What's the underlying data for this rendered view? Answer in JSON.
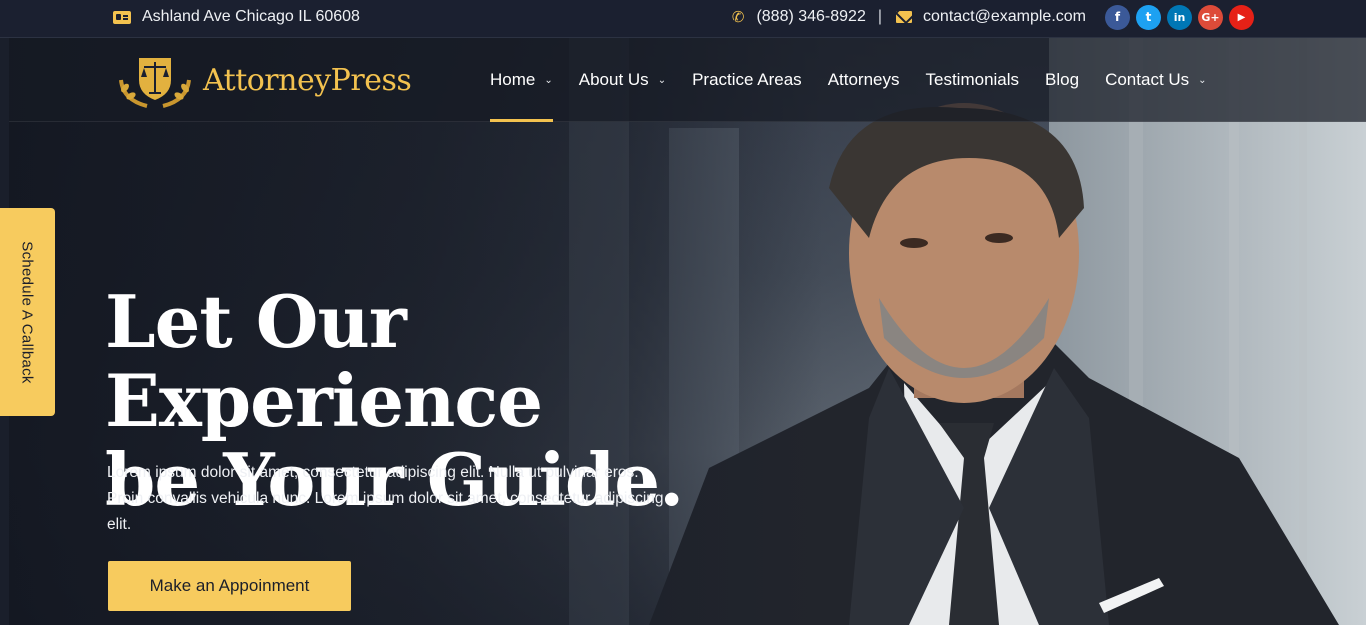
{
  "topbar": {
    "address": "Ashland Ave Chicago IL 60608",
    "phone": "(888) 346-8922",
    "separator": "|",
    "email": "contact@example.com",
    "socials": [
      {
        "icon": "facebook-icon",
        "glyph": "f",
        "color": "#3b5998"
      },
      {
        "icon": "twitter-icon",
        "glyph": "t",
        "color": "#1da1f2"
      },
      {
        "icon": "linkedin-icon",
        "glyph": "in",
        "color": "#0077b5"
      },
      {
        "icon": "google-plus-icon",
        "glyph": "G+",
        "color": "#dd4b39"
      },
      {
        "icon": "youtube-icon",
        "glyph": "▶",
        "color": "#e62117"
      }
    ]
  },
  "brand": {
    "name": "AttorneyPress",
    "accent": "#f3c24f"
  },
  "nav": {
    "items": [
      {
        "label": "Home",
        "dropdown": true,
        "active": true
      },
      {
        "label": "About Us",
        "dropdown": true
      },
      {
        "label": "Practice Areas",
        "dropdown": false
      },
      {
        "label": "Attorneys",
        "dropdown": false
      },
      {
        "label": "Testimonials",
        "dropdown": false
      },
      {
        "label": "Blog",
        "dropdown": false
      },
      {
        "label": "Contact Us",
        "dropdown": true
      }
    ]
  },
  "side_tab": {
    "label": "Schedule A Callback",
    "color": "#f7cb5e"
  },
  "hero": {
    "headline_line1": "Let Our Experience",
    "headline_line2": "be Your Guide.",
    "lead": "Lorem ipsum dolor sit amet, consectetur adipiscing elit. Nulla ut pulvinar eros. Proin convallis vehicula nunc. Lorem ipsum dolor sit amet, consectetur adipiscing elit.",
    "cta_label": "Make an Appoinment",
    "cta_color": "#f7cb5e"
  }
}
